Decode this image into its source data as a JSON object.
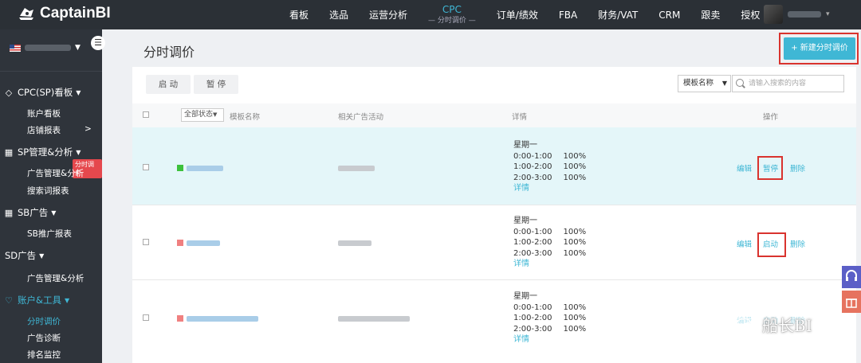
{
  "app": {
    "logo_text": "CaptainBI"
  },
  "topnav": {
    "items": [
      "看板",
      "选品",
      "运营分析"
    ],
    "active": {
      "label": "CPC",
      "sub": "— 分时调价 —"
    },
    "items_right": [
      "订单/绩效",
      "FBA",
      "财务/VAT",
      "CRM",
      "跟卖",
      "授权"
    ]
  },
  "sidebar": {
    "groups": [
      {
        "label": "CPC(SP)看板",
        "items": [
          "账户看板",
          "店铺报表"
        ]
      },
      {
        "label": "SP管理&分析",
        "items": [
          "广告管理&分析",
          "搜索词报表"
        ],
        "badge": "分时调价"
      },
      {
        "label": "SB广告",
        "items": [
          "SB推广报表"
        ]
      },
      {
        "label": "SD广告",
        "items": [
          "广告管理&分析"
        ]
      },
      {
        "label": "账户&工具",
        "items": [
          "分时调价",
          "广告诊断",
          "排名监控"
        ]
      }
    ],
    "arrow": ">"
  },
  "page": {
    "title": "分时调价",
    "new_button": "+ 新建分时调价",
    "start_button": "启 动",
    "pause_button": "暂 停",
    "filter_select": "模板名称",
    "search_placeholder": "请输入搜索的内容"
  },
  "table": {
    "status_filter": "全部状态",
    "columns": [
      "模板名称",
      "相关广告活动",
      "详情",
      "操作"
    ],
    "rows": [
      {
        "status_color": "#3cc13c",
        "detail": {
          "day": "星期一",
          "lines": [
            [
              "0:00-1:00",
              "100%"
            ],
            [
              "1:00-2:00",
              "100%"
            ],
            [
              "2:00-3:00",
              "100%"
            ]
          ],
          "more": "详情"
        },
        "ops": [
          "编辑",
          "暂停",
          "删除"
        ]
      },
      {
        "status_color": "#f08080",
        "detail": {
          "day": "星期一",
          "lines": [
            [
              "0:00-1:00",
              "100%"
            ],
            [
              "1:00-2:00",
              "100%"
            ],
            [
              "2:00-3:00",
              "100%"
            ]
          ],
          "more": "详情"
        },
        "ops": [
          "编辑",
          "启动",
          "删除"
        ]
      },
      {
        "status_color": "#f08080",
        "detail": {
          "day": "星期一",
          "lines": [
            [
              "0:00-1:00",
              "100%"
            ],
            [
              "1:00-2:00",
              "100%"
            ],
            [
              "2:00-3:00",
              "100%"
            ]
          ],
          "more": "详情"
        },
        "ops": [
          "编辑",
          "启动",
          "删除"
        ]
      }
    ]
  },
  "watermark": "船长BI",
  "colors": {
    "accent": "#3fb7d5",
    "highlight": "#d9332e",
    "sidebar": "#2f343b",
    "topbar": "#2b3036"
  }
}
